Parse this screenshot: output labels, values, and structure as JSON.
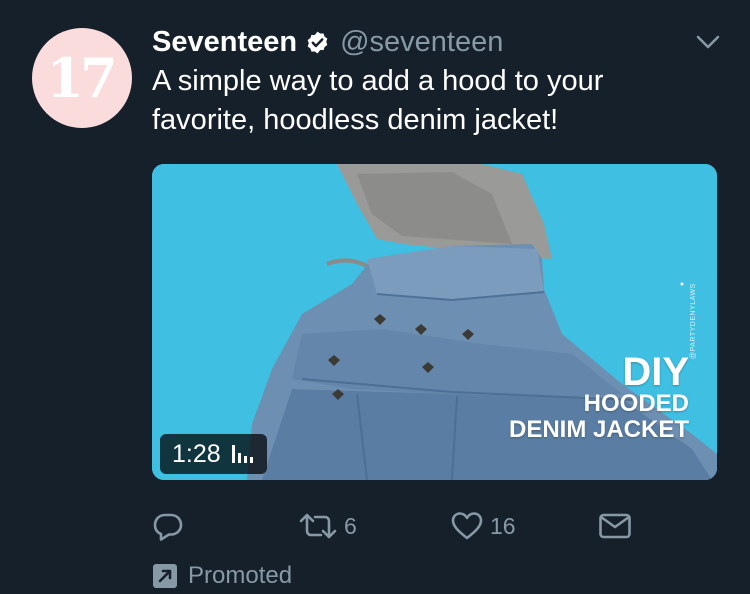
{
  "tweet": {
    "avatar_text": "17",
    "name": "Seventeen",
    "handle": "@seventeen",
    "text_line1": "A simple way to add a hood to your",
    "text_line2": "favorite, hoodless denim jacket!"
  },
  "media": {
    "watermark": "@PARTYDENYLAWS",
    "overlay_line1": "DIY",
    "overlay_line2": "HOODED",
    "overlay_line3": "DENIM JACKET",
    "duration": "1:28"
  },
  "actions": {
    "reply_count": "",
    "retweet_count": "6",
    "like_count": "16"
  },
  "promoted_label": "Promoted",
  "colors": {
    "background": "#15202b",
    "secondary_text": "#8899a6",
    "avatar_bg": "#fadcdd",
    "media_bg": "#3fbfe1"
  },
  "icons": [
    "verified-badge-icon",
    "chevron-down-icon",
    "sound-bars-icon",
    "reply-icon",
    "retweet-icon",
    "like-icon",
    "direct-message-icon",
    "promoted-arrow-icon"
  ]
}
